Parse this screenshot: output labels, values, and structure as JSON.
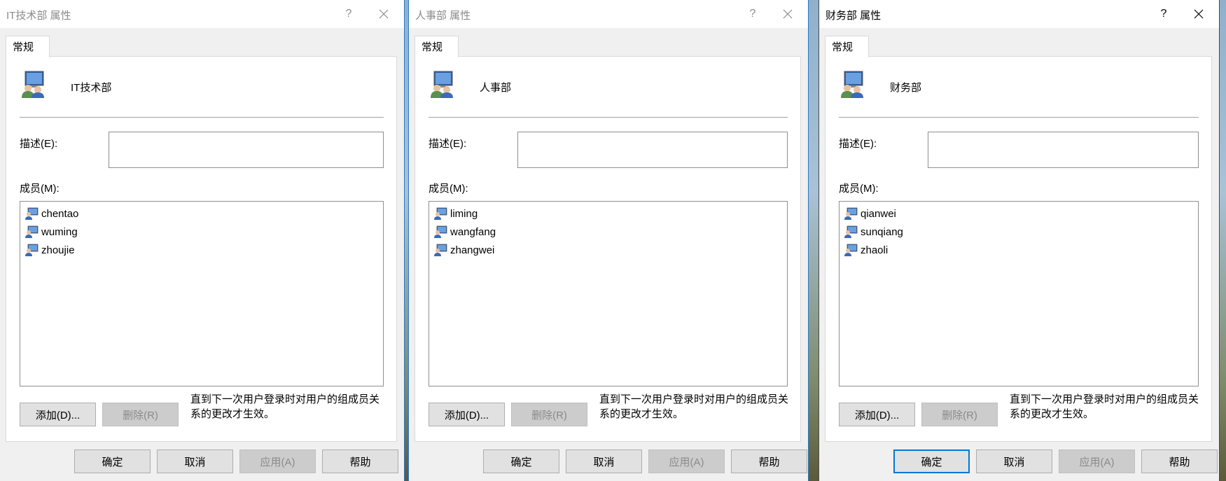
{
  "dialogs": [
    {
      "title": "IT技术部 属性",
      "help_glyph": "?",
      "tab": "常规",
      "group_name": "IT技术部",
      "description_label": "描述(E):",
      "description_value": "",
      "members_label": "成员(M):",
      "members": [
        {
          "name": "chentao"
        },
        {
          "name": "wuming"
        },
        {
          "name": "zhoujie"
        }
      ],
      "add_label": "添加(D)...",
      "remove_label": "删除(R)",
      "note": "直到下一次用户登录时对用户的组成员关系的更改才生效。",
      "ok_label": "确定",
      "cancel_label": "取消",
      "apply_label": "应用(A)",
      "help_label": "帮助"
    },
    {
      "title": "人事部 属性",
      "help_glyph": "?",
      "tab": "常规",
      "group_name": "人事部",
      "description_label": "描述(E):",
      "description_value": "",
      "members_label": "成员(M):",
      "members": [
        {
          "name": "liming"
        },
        {
          "name": "wangfang"
        },
        {
          "name": "zhangwei"
        }
      ],
      "add_label": "添加(D)...",
      "remove_label": "删除(R)",
      "note": "直到下一次用户登录时对用户的组成员关系的更改才生效。",
      "ok_label": "确定",
      "cancel_label": "取消",
      "apply_label": "应用(A)",
      "help_label": "帮助"
    },
    {
      "title": "财务部 属性",
      "help_glyph": "?",
      "tab": "常规",
      "group_name": "财务部",
      "description_label": "描述(E):",
      "description_value": "",
      "members_label": "成员(M):",
      "members": [
        {
          "name": "qianwei"
        },
        {
          "name": "sunqiang"
        },
        {
          "name": "zhaoli"
        }
      ],
      "add_label": "添加(D)...",
      "remove_label": "删除(R)",
      "note": "直到下一次用户登录时对用户的组成员关系的更改才生效。",
      "ok_label": "确定",
      "cancel_label": "取消",
      "apply_label": "应用(A)",
      "help_label": "帮助"
    }
  ],
  "icons": {
    "group": "group-users-icon",
    "user": "user-icon",
    "help": "help-icon",
    "close": "close-icon"
  },
  "colors": {
    "active_border": "#2b79c9",
    "default_button_border": "#0078d7"
  }
}
